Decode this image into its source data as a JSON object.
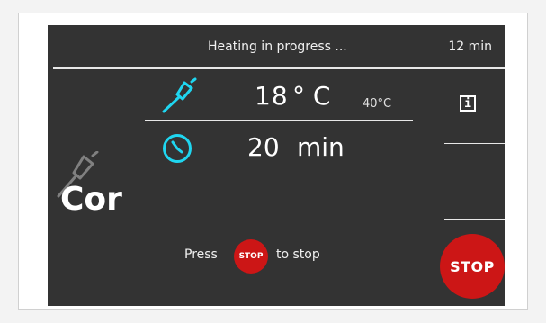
{
  "header": {
    "status": "Heating in progress ...",
    "elapsed_time": "12 min"
  },
  "probe": {
    "temperature": "18",
    "unit": "° C",
    "target": "40°C"
  },
  "timer": {
    "value": "20",
    "unit": "min"
  },
  "mode": {
    "label": "Cor"
  },
  "info_button": {
    "label": "i"
  },
  "hint": {
    "press": "Press",
    "button_label": "STOP",
    "after": "to stop"
  },
  "stop_button": {
    "label": "STOP"
  },
  "colors": {
    "accent_cyan": "#1fd6f0",
    "stop_red": "#cc1616",
    "screen_bg": "#333333"
  },
  "icons": {
    "probe": "probe-icon",
    "clock": "clock-icon",
    "mode_probe": "probe-icon"
  }
}
